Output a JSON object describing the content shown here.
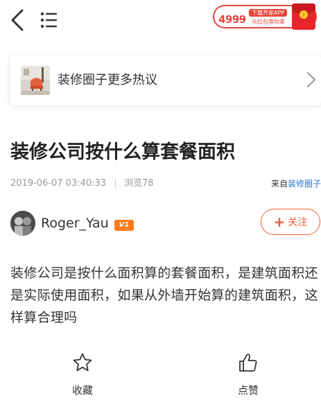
{
  "promo": {
    "amount": "4999",
    "line1": "下载齐家APP",
    "line2": "元红包等你拿"
  },
  "circle_link": {
    "label": "装修圈子更多热议"
  },
  "article": {
    "title": "装修公司按什么算套餐面积",
    "date": "2019-06-07 03:40:33",
    "views": "浏览78",
    "source_prefix": "来自",
    "source_name": "装修圈子",
    "body": "装修公司是按什么面积算的套餐面积，是建筑面积还是实际使用面积，如果从外墙开始算的建筑面积，这样算合理吗"
  },
  "author": {
    "name": "Roger_Yau",
    "badge": "V1",
    "follow_label": "关注"
  },
  "actions": {
    "favorite_label": "收藏",
    "like_label": "点赞"
  },
  "colors": {
    "accent": "#f15a3a",
    "link": "#2b74d6",
    "badge": "#ff7a1a",
    "promo_red": "#e8443a"
  },
  "icons": [
    "back-arrow-icon",
    "list-menu-icon",
    "red-envelope-icon",
    "chevron-right-icon",
    "star-icon",
    "thumbs-up-icon",
    "plus-icon"
  ]
}
